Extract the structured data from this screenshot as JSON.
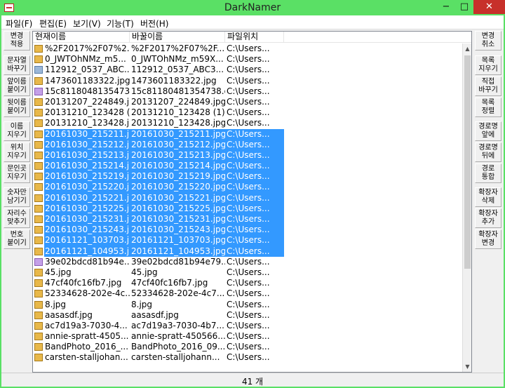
{
  "window": {
    "title": "DarkNamer",
    "min": "−",
    "max": "□",
    "close": "✕"
  },
  "menu": [
    "파일(F)",
    "편집(E)",
    "보기(V)",
    "기능(T)",
    "버전(H)"
  ],
  "left_buttons": [
    "변경\n적용",
    "문자열\n바꾸기",
    "앞이름\n붙이기",
    "뒷이름\n붙이기",
    "이름\n지우기",
    "위치\n지우기",
    "문인곳\n지우기",
    "숫자만\n남기기",
    "자리수\n맞추기",
    "번호\n붙이기"
  ],
  "right_buttons": [
    "변경\n취소",
    "목록\n지우기",
    "직접\n바꾸기",
    "목록\n정렬",
    "경로명\n앞에",
    "경로명\n뒤에",
    "경로\n통합",
    "확장자\n삭제",
    "확장자\n추가",
    "확장자\n변경"
  ],
  "columns": [
    "현재이름",
    "바꿀이름",
    "파일위치"
  ],
  "files": [
    {
      "cur": "%2F2017%2F07%2...",
      "new": "%2F2017%2F07%2F...",
      "loc": "C:\\Users...",
      "type": "jpg",
      "sel": false
    },
    {
      "cur": "0_JWTOhNMz_m5...",
      "new": "0_JWTOhNMz_m59X...",
      "loc": "C:\\Users...",
      "type": "jpg",
      "sel": false
    },
    {
      "cur": "112912_0537_ABC...",
      "new": "112912_0537_ABC3...",
      "loc": "C:\\Users...",
      "type": "png",
      "sel": false
    },
    {
      "cur": "1473601183322.jpg",
      "new": "1473601183322.jpg",
      "loc": "C:\\Users...",
      "type": "jpg",
      "sel": false
    },
    {
      "cur": "15c8118048135473...",
      "new": "15c81180481354738.gif",
      "loc": "C:\\Users...",
      "type": "gif",
      "sel": false
    },
    {
      "cur": "20131207_224849.jpg",
      "new": "20131207_224849.jpg",
      "loc": "C:\\Users...",
      "type": "jpg",
      "sel": false
    },
    {
      "cur": "20131210_123428 (...",
      "new": "20131210_123428 (1)...",
      "loc": "C:\\Users...",
      "type": "jpg",
      "sel": false
    },
    {
      "cur": "20131210_123428.jpg",
      "new": "20131210_123428.jpg",
      "loc": "C:\\Users...",
      "type": "jpg",
      "sel": false
    },
    {
      "cur": "20161030_215211.jpg",
      "new": "20161030_215211.jpg",
      "loc": "C:\\Users...",
      "type": "jpg",
      "sel": true
    },
    {
      "cur": "20161030_215212.jpg",
      "new": "20161030_215212.jpg",
      "loc": "C:\\Users...",
      "type": "jpg",
      "sel": true
    },
    {
      "cur": "20161030_215213.jpg",
      "new": "20161030_215213.jpg",
      "loc": "C:\\Users...",
      "type": "jpg",
      "sel": true
    },
    {
      "cur": "20161030_215214.jpg",
      "new": "20161030_215214.jpg",
      "loc": "C:\\Users...",
      "type": "jpg",
      "sel": true
    },
    {
      "cur": "20161030_215219.jpg",
      "new": "20161030_215219.jpg",
      "loc": "C:\\Users...",
      "type": "jpg",
      "sel": true
    },
    {
      "cur": "20161030_215220.jpg",
      "new": "20161030_215220.jpg",
      "loc": "C:\\Users...",
      "type": "jpg",
      "sel": true
    },
    {
      "cur": "20161030_215221.jpg",
      "new": "20161030_215221.jpg",
      "loc": "C:\\Users...",
      "type": "jpg",
      "sel": true
    },
    {
      "cur": "20161030_215225.jpg",
      "new": "20161030_215225.jpg",
      "loc": "C:\\Users...",
      "type": "jpg",
      "sel": true
    },
    {
      "cur": "20161030_215231.jpg",
      "new": "20161030_215231.jpg",
      "loc": "C:\\Users...",
      "type": "jpg",
      "sel": true
    },
    {
      "cur": "20161030_215243.jpg",
      "new": "20161030_215243.jpg",
      "loc": "C:\\Users...",
      "type": "jpg",
      "sel": true
    },
    {
      "cur": "20161121_103703.jpg",
      "new": "20161121_103703.jpg",
      "loc": "C:\\Users...",
      "type": "jpg",
      "sel": true
    },
    {
      "cur": "20161121_104953.jpg",
      "new": "20161121_104953.jpg",
      "loc": "C:\\Users...",
      "type": "jpg",
      "sel": true
    },
    {
      "cur": "39e02bdcd81b94e...",
      "new": "39e02bdcd81b94e79...",
      "loc": "C:\\Users...",
      "type": "gif",
      "sel": false
    },
    {
      "cur": "45.jpg",
      "new": "45.jpg",
      "loc": "C:\\Users...",
      "type": "jpg",
      "sel": false
    },
    {
      "cur": "47cf40fc16fb7.jpg",
      "new": "47cf40fc16fb7.jpg",
      "loc": "C:\\Users...",
      "type": "jpg",
      "sel": false
    },
    {
      "cur": "52334628-202e-4c...",
      "new": "52334628-202e-4c7...",
      "loc": "C:\\Users...",
      "type": "jpg",
      "sel": false
    },
    {
      "cur": "8.jpg",
      "new": "8.jpg",
      "loc": "C:\\Users...",
      "type": "jpg",
      "sel": false
    },
    {
      "cur": "aasasdf.jpg",
      "new": "aasasdf.jpg",
      "loc": "C:\\Users...",
      "type": "jpg",
      "sel": false
    },
    {
      "cur": "ac7d19a3-7030-4...",
      "new": "ac7d19a3-7030-4b7...",
      "loc": "C:\\Users...",
      "type": "jpg",
      "sel": false
    },
    {
      "cur": "annie-spratt-4505...",
      "new": "annie-spratt-450566...",
      "loc": "C:\\Users...",
      "type": "jpg",
      "sel": false
    },
    {
      "cur": "BandPhoto_2016_...",
      "new": "BandPhoto_2016_09...",
      "loc": "C:\\Users...",
      "type": "jpg",
      "sel": false
    },
    {
      "cur": "carsten-stalljohan...",
      "new": "carsten-stalljohann...",
      "loc": "C:\\Users...",
      "type": "jpg",
      "sel": false
    }
  ],
  "status": "41 개",
  "colors": {
    "titlebar": "#5ae065",
    "selection": "#3399ff",
    "close": "#c7302a"
  }
}
